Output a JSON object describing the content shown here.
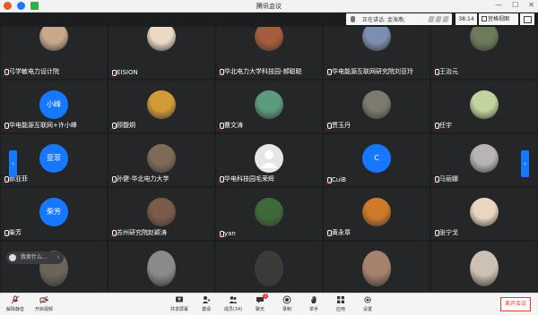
{
  "window": {
    "title": "腾讯会议"
  },
  "speaking": {
    "label": "正在讲话: 金海燕;"
  },
  "timer": "38:14",
  "view_button": "宫格视图",
  "chat_popup": "我卖什么...",
  "pager": {
    "prev": "‹",
    "next": "›"
  },
  "tiles": [
    {
      "name": "弓学敏电力设计院",
      "type": "photo",
      "color": "#c9a98a"
    },
    {
      "name": "EISION",
      "type": "photo",
      "color": "#e9d9c5"
    },
    {
      "name": "华北电力大学科技园-郝聪聪",
      "type": "photo",
      "color": "#a55d3d"
    },
    {
      "name": "华电能源互联网研究院刘亚玲",
      "type": "photo",
      "color": "#7c8fb1"
    },
    {
      "name": "王治元",
      "type": "photo",
      "color": "#6d7a5b"
    },
    {
      "name": "华电能源互联网+许小峰",
      "type": "initial",
      "initial": "小峰",
      "color": "#1677ff"
    },
    {
      "name": "顾馥炯",
      "type": "photo",
      "color": "#d29b36"
    },
    {
      "name": "曹文涛",
      "type": "photo",
      "color": "#5d9b7e"
    },
    {
      "name": "贾玉丹",
      "type": "photo",
      "color": "#7a7a6e"
    },
    {
      "name": "任宇",
      "type": "photo",
      "color": "#c3d49e"
    },
    {
      "name": "郝亚菲",
      "type": "initial",
      "initial": "亚菲",
      "color": "#1677ff"
    },
    {
      "name": "孙健-华北电力大学",
      "type": "photo",
      "color": "#7d6a57"
    },
    {
      "name": "华电科技园毛荣辉",
      "type": "default",
      "color": "#e6e6e6"
    },
    {
      "name": "CuiB",
      "type": "initial",
      "initial": "C",
      "color": "#1677ff"
    },
    {
      "name": "马丽娜",
      "type": "photo",
      "color": "#b8b3b4"
    },
    {
      "name": "柴芳",
      "type": "initial",
      "initial": "柴芳",
      "color": "#1677ff"
    },
    {
      "name": "苏州研究院赵颖涛",
      "type": "photo",
      "color": "#7a5a49"
    },
    {
      "name": "yan",
      "type": "photo",
      "color": "#3e6a3a"
    },
    {
      "name": "黄永章",
      "type": "photo",
      "color": "#cf7a2a"
    },
    {
      "name": "张宁戈",
      "type": "photo",
      "color": "#e9d6c0"
    },
    {
      "name": "",
      "type": "photo",
      "color": "#6b6459"
    },
    {
      "name": "",
      "type": "photo",
      "color": "#8a8a8a"
    },
    {
      "name": "",
      "type": "photo",
      "color": "#3d3b3a"
    },
    {
      "name": "",
      "type": "photo",
      "color": "#a6826a"
    },
    {
      "name": "",
      "type": "photo",
      "color": "#ccc1b4"
    }
  ],
  "toolbar": {
    "items": [
      {
        "label": "解除静音",
        "icon": "mic-off-icon"
      },
      {
        "label": "开启视频",
        "icon": "video-off-icon"
      },
      {
        "label": "共享屏幕",
        "icon": "share-screen-icon"
      },
      {
        "label": "邀请",
        "icon": "invite-icon"
      },
      {
        "label": "成员(34)",
        "icon": "members-icon"
      },
      {
        "label": "聊天",
        "icon": "chat-icon"
      },
      {
        "label": "录制",
        "icon": "record-icon"
      },
      {
        "label": "举手",
        "icon": "raise-hand-icon"
      },
      {
        "label": "应用",
        "icon": "apps-icon"
      },
      {
        "label": "设置",
        "icon": "settings-icon"
      }
    ],
    "chat_badge": "1",
    "leave_label": "离开会议"
  },
  "colors": {
    "accent": "#1677ff",
    "danger": "#e33333"
  }
}
